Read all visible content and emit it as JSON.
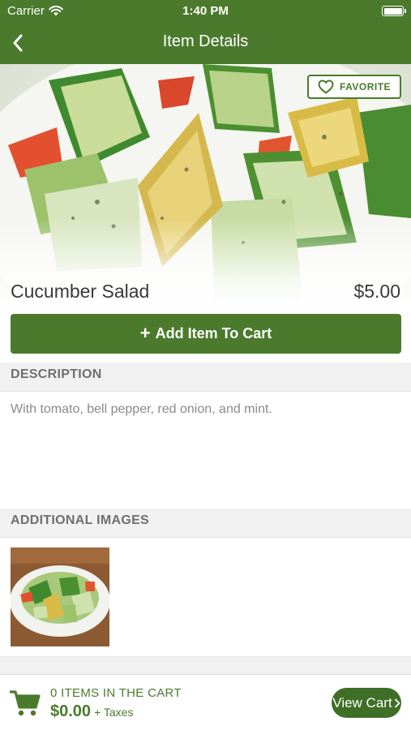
{
  "status": {
    "carrier": "Carrier",
    "time": "1:40 PM"
  },
  "nav": {
    "title": "Item Details"
  },
  "item": {
    "favorite_label": "FAVORITE",
    "name": "Cucumber Salad",
    "price": "$5.00",
    "add_label": "Add Item To Cart"
  },
  "description": {
    "heading": "DESCRIPTION",
    "text": "With tomato, bell pepper, red onion, and mint."
  },
  "additional_images": {
    "heading": "ADDITIONAL IMAGES"
  },
  "cart": {
    "count_text": "0 ITEMS IN THE CART",
    "total": "$0.00",
    "taxes_label": "+ Taxes",
    "view_label": "View Cart"
  },
  "colors": {
    "brand_green": "#4b7a2d",
    "dark_green": "#3f6f26"
  },
  "icons": [
    "wifi-icon",
    "battery-icon",
    "back-chevron-icon",
    "heart-icon",
    "plus-icon",
    "cart-icon",
    "chevron-right-icon"
  ]
}
